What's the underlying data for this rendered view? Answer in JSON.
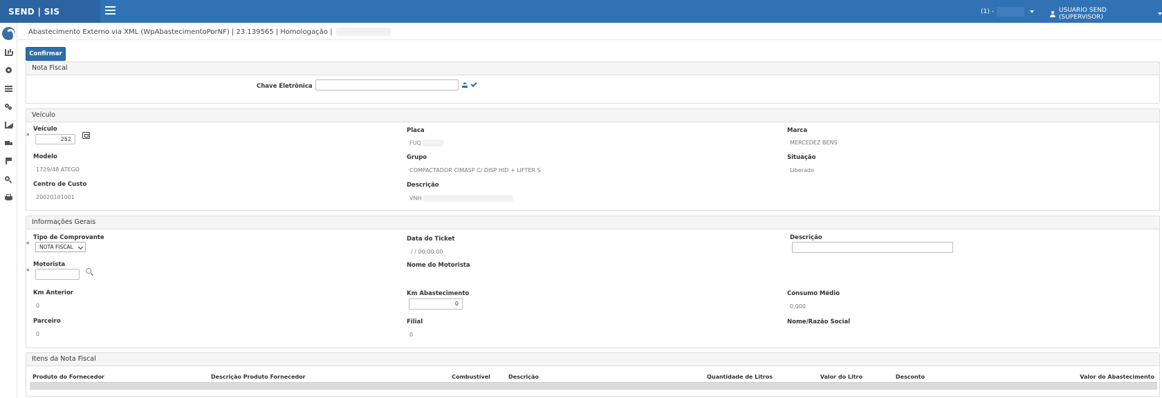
{
  "app": {
    "brand": "SEND | SIS",
    "company_label": "(1) -",
    "user_label": "USUARIO SEND (SUPERVISOR)"
  },
  "sidebar": {
    "items": [
      "chart-icon",
      "gear-icon",
      "list-icon",
      "gears-icon",
      "area-chart-icon",
      "truck-icon",
      "flag-icon",
      "search-icon",
      "print-icon"
    ]
  },
  "page": {
    "title": "Abastecimento Externo via XML (WpAbastecimentoPorNF) | 23.139565 | Homologação |",
    "confirm_label": "Confirmar"
  },
  "nota_fiscal": {
    "heading": "Nota Fiscal",
    "chave_label": "Chave Eletrônica",
    "chave_value": ""
  },
  "veiculo": {
    "heading": "Veículo",
    "veiculo_label": "Veículo",
    "veiculo_value": "252",
    "placa_label": "Placa",
    "placa_value": "FUQ",
    "marca_label": "Marca",
    "marca_value": "MERCEDEZ BENS",
    "modelo_label": "Modelo",
    "modelo_value": "1729/48 ATEGO",
    "grupo_label": "Grupo",
    "grupo_value": "COMPACTADOR CIMASP C/ DISP HID + LIFTER S",
    "situacao_label": "Situação",
    "situacao_value": "Liberado",
    "centro_label": "Centro de Custo",
    "centro_value": "20020101001",
    "descricao_label": "Descrição",
    "descricao_value": "VNH"
  },
  "info": {
    "heading": "Informações Gerais",
    "tipo_label": "Tipo de Comprovante",
    "tipo_value": "NOTA FISCAL",
    "data_label": "Data do Ticket",
    "data_value": "/  / 00:00:00",
    "descricao_label": "Descrição",
    "descricao_value": "",
    "motorista_label": "Motorista",
    "motorista_value": "",
    "nome_motorista_label": "Nome do Motorista",
    "km_anterior_label": "Km Anterior",
    "km_anterior_value": "0",
    "km_abast_label": "Km Abastecimento",
    "km_abast_value": "0",
    "consumo_label": "Consumo Médio",
    "consumo_value": "0,000",
    "parceiro_label": "Parceiro",
    "parceiro_value": "0",
    "filial_label": "Filial",
    "filial_value": "0",
    "razao_label": "Nome/Razão Social"
  },
  "itens": {
    "heading": "Itens da Nota Fiscal",
    "columns": [
      "Produto do Fornecedor",
      "Descrição Produto Fornecedor",
      "Combustível",
      "Descrição",
      "Quantidade de Litros",
      "Valor do Litro",
      "Desconto",
      "Valor do Abastecimento"
    ]
  }
}
